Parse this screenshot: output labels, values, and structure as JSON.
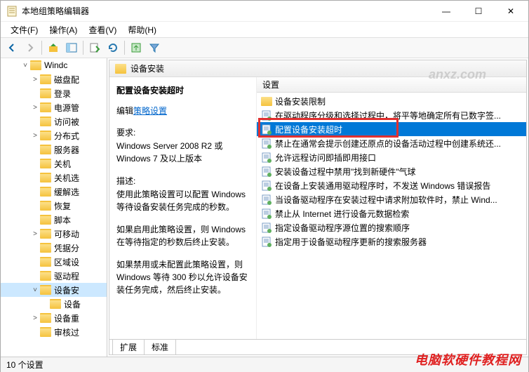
{
  "window": {
    "title": "本地组策略编辑器",
    "min": "—",
    "max": "☐",
    "close": "✕"
  },
  "menu": {
    "file": "文件(F)",
    "action": "操作(A)",
    "view": "查看(V)",
    "help": "帮助(H)"
  },
  "tree": {
    "items": [
      {
        "label": "Windc",
        "exp": "˅",
        "indent": 28
      },
      {
        "label": "磁盘配",
        "exp": "˃",
        "indent": 42
      },
      {
        "label": "登录",
        "exp": "",
        "indent": 42
      },
      {
        "label": "电源管",
        "exp": "˃",
        "indent": 42
      },
      {
        "label": "访问被",
        "exp": "",
        "indent": 42
      },
      {
        "label": "分布式",
        "exp": "˃",
        "indent": 42
      },
      {
        "label": "服务器",
        "exp": "",
        "indent": 42
      },
      {
        "label": "关机",
        "exp": "",
        "indent": 42
      },
      {
        "label": "关机选",
        "exp": "",
        "indent": 42
      },
      {
        "label": "缓解选",
        "exp": "",
        "indent": 42
      },
      {
        "label": "恢复",
        "exp": "",
        "indent": 42
      },
      {
        "label": "脚本",
        "exp": "",
        "indent": 42
      },
      {
        "label": "可移动",
        "exp": "˃",
        "indent": 42
      },
      {
        "label": "凭据分",
        "exp": "",
        "indent": 42
      },
      {
        "label": "区域设",
        "exp": "",
        "indent": 42
      },
      {
        "label": "驱动程",
        "exp": "",
        "indent": 42
      },
      {
        "label": "设备安",
        "exp": "˅",
        "indent": 42,
        "selected": true
      },
      {
        "label": "设备",
        "exp": "",
        "indent": 56
      },
      {
        "label": "设备重",
        "exp": "˃",
        "indent": 42
      },
      {
        "label": "审核过",
        "exp": "",
        "indent": 42
      }
    ]
  },
  "detail": {
    "header": "设备安装",
    "title": "配置设备安装超时",
    "edit_prefix": "编辑",
    "edit_link": "策略设置",
    "req_label": "要求:",
    "req_text": "Windows Server 2008 R2 或 Windows 7 及以上版本",
    "desc_label": "描述:",
    "desc_1": "使用此策略设置可以配置 Windows 等待设备安装任务完成的秒数。",
    "desc_2": "如果启用此策略设置，则 Windows 在等待指定的秒数后终止安装。",
    "desc_3": "如果禁用或未配置此策略设置，则 Windows 等待 300 秒以允许设备安装任务完成，然后终止安装。"
  },
  "list": {
    "header": "设置",
    "items": [
      {
        "type": "folder",
        "label": "设备安装限制"
      },
      {
        "type": "doc",
        "label": "在驱动程序分级和选择过程中，将平等地确定所有已数字签..."
      },
      {
        "type": "doc",
        "label": "配置设备安装超时",
        "selected": true
      },
      {
        "type": "doc",
        "label": "禁止在通常会提示创建还原点的设备活动过程中创建系统还..."
      },
      {
        "type": "doc",
        "label": "允许远程访问即插即用接口"
      },
      {
        "type": "doc",
        "label": "安装设备过程中禁用\"找到新硬件\"气球"
      },
      {
        "type": "doc",
        "label": "在设备上安装通用驱动程序时，不发送 Windows 错误报告"
      },
      {
        "type": "doc",
        "label": "当设备驱动程序在安装过程中请求附加软件时，禁止 Wind..."
      },
      {
        "type": "doc",
        "label": "禁止从 Internet 进行设备元数据检索"
      },
      {
        "type": "doc",
        "label": "指定设备驱动程序源位置的搜索顺序"
      },
      {
        "type": "doc",
        "label": "指定用于设备驱动程序更新的搜索服务器"
      }
    ]
  },
  "tabs": {
    "extended": "扩展",
    "standard": "标准"
  },
  "status": {
    "text": "10 个设置"
  },
  "watermark": "电脑软硬件教程网",
  "wm2": "anxz.com"
}
